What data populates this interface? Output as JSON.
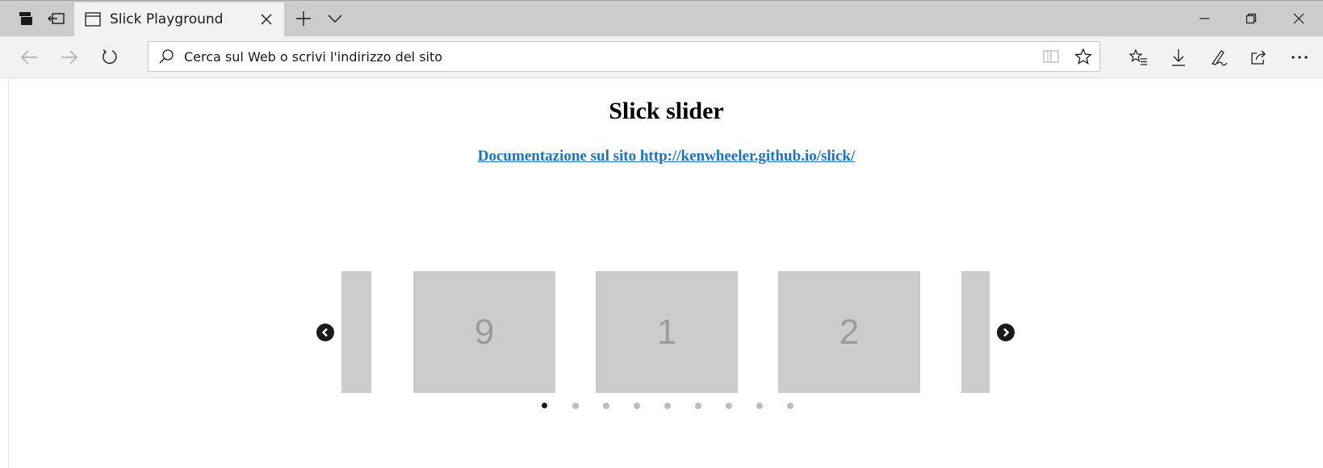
{
  "browser": {
    "tab": {
      "title": "Slick Playground"
    },
    "address": {
      "placeholder": "Cerca sul Web o scrivi l'indirizzo del sito"
    }
  },
  "page": {
    "title": "Slick slider",
    "link_text": "Documentazione sul sito http://kenwheeler.github.io/slick/",
    "slides": [
      "9",
      "1",
      "2"
    ],
    "dots_count": 9,
    "active_dot": 0
  },
  "colors": {
    "tabbar": "#cccccc",
    "toolbar": "#f2f2f2",
    "slide": "#cccccc",
    "link": "#1a73c8"
  }
}
